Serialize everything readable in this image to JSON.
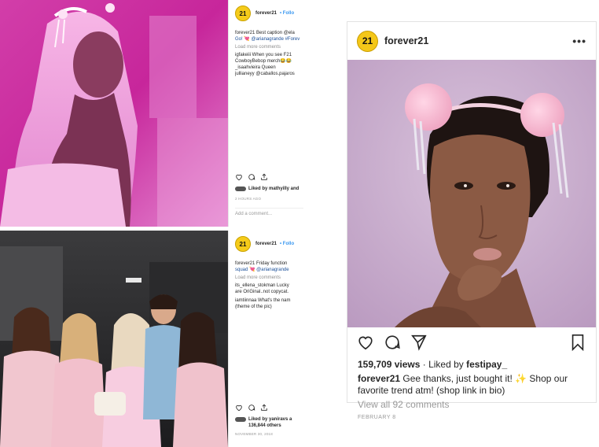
{
  "colors": {
    "brand_yellow": "#f4c719",
    "link_blue": "#3897f0",
    "muted": "#8e8e8e"
  },
  "top_post": {
    "logo_text": "21",
    "username": "forever21",
    "follow": "• Follo",
    "caption_line1": "forever21 Best caption @ela",
    "caption_line2": "Go! 💘 @arianagrande #Forev",
    "load_more": "Load more comments",
    "comment1_line1": "igfakeiii When you see F21",
    "comment1_line2": "CowboyBebop merch😂😂",
    "comment2": "_isaahvieira Queen",
    "comment3": "jullianeyy @caballos.pajaros",
    "icons": [
      "heart-icon",
      "comment-icon",
      "share-icon"
    ],
    "liked_by": "Liked by mathyilly and",
    "date": "2 HOURS AGO",
    "add_comment": "Add a comment..."
  },
  "bottom_post": {
    "logo_text": "21",
    "username": "forever21",
    "follow": "• Follo",
    "caption_line1": "forever21 Friday function",
    "caption_line2": "squad 💘 @arianagrande",
    "load_more": "Load more comments",
    "comment1_line1": "its_ellena_stokman Lucky",
    "comment1_line2": "are OriGinal..not copycat.",
    "comment2_line1": "iamtiinnaa What's the nam",
    "comment2_line2": "(theme of the pic)",
    "icons": [
      "heart-icon",
      "comment-icon",
      "share-icon"
    ],
    "liked_by_line1": "Liked by yaniravs a",
    "liked_by_line2": "136,844 others",
    "date": "NOVEMBER 30, 2018"
  },
  "main_post": {
    "logo_text": "21",
    "username": "forever21",
    "menu": "•••",
    "icons": [
      "heart-icon",
      "comment-icon",
      "send-icon",
      "bookmark-icon"
    ],
    "views": "159,709 views",
    "liked_prefix": " · Liked by ",
    "liked_user": "festipay_",
    "caption_user": "forever21",
    "caption_text": " Gee thanks, just bought it! ✨ Shop our favorite trend atm! (shop link in bio)",
    "view_all": "View all 92 comments",
    "date": "FEBRUARY 8"
  }
}
